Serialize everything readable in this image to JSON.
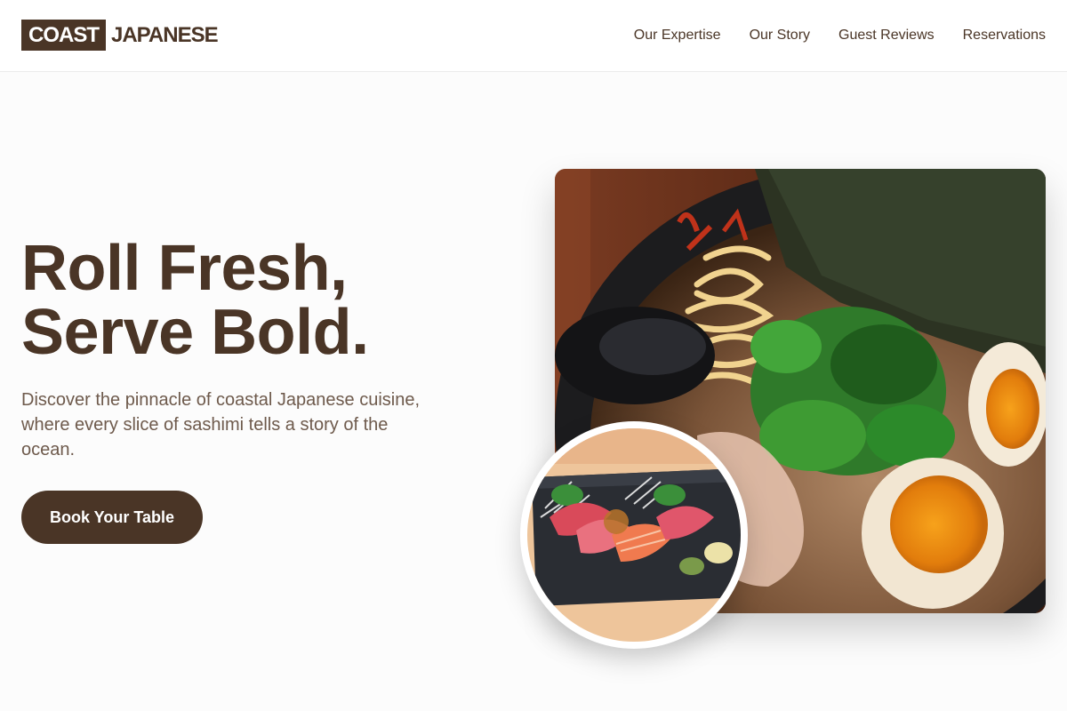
{
  "header": {
    "logo_box": "COAST",
    "logo_text": "JAPANESE",
    "nav": [
      "Our Expertise",
      "Our Story",
      "Guest Reviews",
      "Reservations"
    ]
  },
  "hero": {
    "title_line1": "Roll Fresh,",
    "title_line2": "Serve Bold.",
    "subtitle": "Discover the pinnacle of coastal Japanese cuisine, where every slice of sashimi tells a story of the ocean.",
    "cta": "Book Your Table"
  },
  "images": {
    "main": "ramen-bowl-photo",
    "secondary": "sashimi-platter-photo"
  },
  "colors": {
    "brand": "#4a3526",
    "text_muted": "#6e5a4c",
    "background": "#fcfcfc"
  }
}
